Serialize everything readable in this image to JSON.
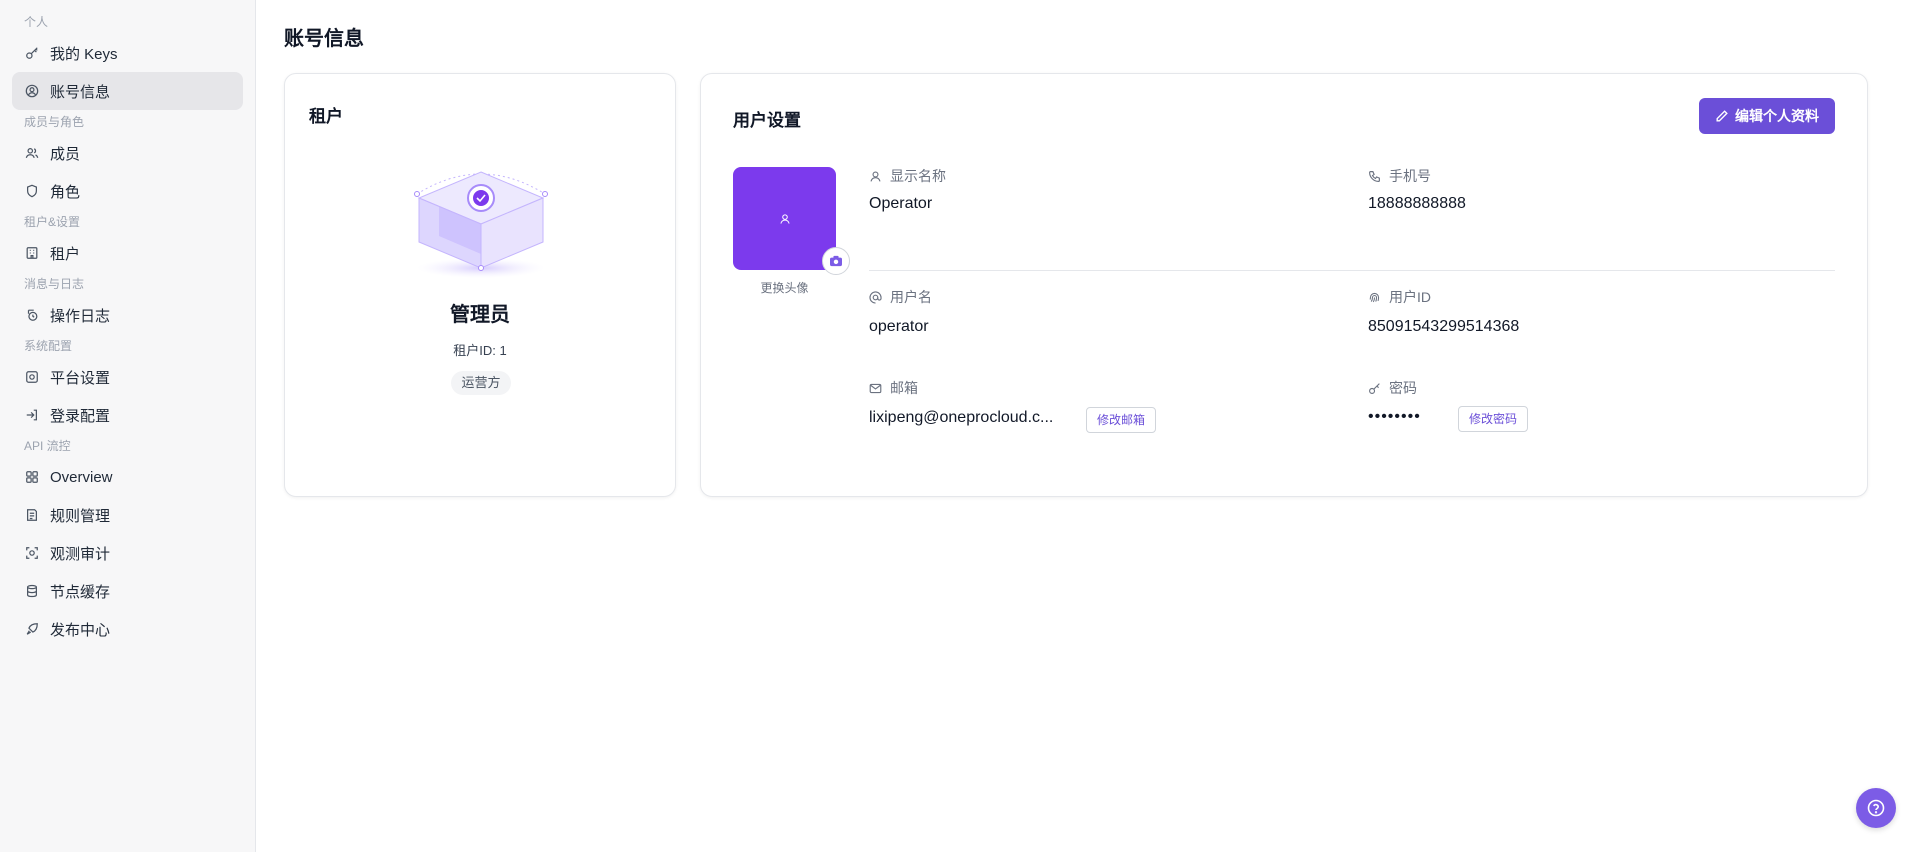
{
  "sidebar": {
    "groups": [
      {
        "label": "个人",
        "items": [
          {
            "label": "我的 Keys",
            "icon": "key-icon"
          },
          {
            "label": "账号信息",
            "icon": "user-circle-icon",
            "active": true
          }
        ]
      },
      {
        "label": "成员与角色",
        "items": [
          {
            "label": "成员",
            "icon": "users-icon"
          },
          {
            "label": "角色",
            "icon": "shield-icon"
          }
        ]
      },
      {
        "label": "租户&设置",
        "items": [
          {
            "label": "租户",
            "icon": "building-icon"
          }
        ]
      },
      {
        "label": "消息与日志",
        "items": [
          {
            "label": "操作日志",
            "icon": "log-icon"
          }
        ]
      },
      {
        "label": "系统配置",
        "items": [
          {
            "label": "平台设置",
            "icon": "settings-icon"
          },
          {
            "label": "登录配置",
            "icon": "login-icon"
          }
        ]
      },
      {
        "label": "API 流控",
        "items": [
          {
            "label": "Overview",
            "icon": "grid-icon"
          },
          {
            "label": "规则管理",
            "icon": "rules-icon"
          },
          {
            "label": "观测审计",
            "icon": "scan-icon"
          },
          {
            "label": "节点缓存",
            "icon": "database-icon"
          },
          {
            "label": "发布中心",
            "icon": "rocket-icon"
          }
        ]
      }
    ]
  },
  "page": {
    "title": "账号信息"
  },
  "tenant_card": {
    "title": "租户",
    "role_name": "管理员",
    "tenant_id_label": "租户ID: 1",
    "badge": "运营方"
  },
  "user_card": {
    "title": "用户设置",
    "edit_button": "编辑个人资料",
    "avatar_caption": "更换头像",
    "fields": {
      "display_name": {
        "label": "显示名称",
        "value": "Operator"
      },
      "phone": {
        "label": "手机号",
        "value": "18888888888"
      },
      "username": {
        "label": "用户名",
        "value": "operator"
      },
      "user_id": {
        "label": "用户ID",
        "value": "85091543299514368"
      },
      "email": {
        "label": "邮箱",
        "value": "lixipeng@oneprocloud.c...",
        "action": "修改邮箱"
      },
      "password": {
        "label": "密码",
        "value": "••••••••",
        "action": "修改密码"
      }
    }
  },
  "colors": {
    "accent": "#6b4fd8",
    "avatar_bg": "#7c3aed"
  }
}
